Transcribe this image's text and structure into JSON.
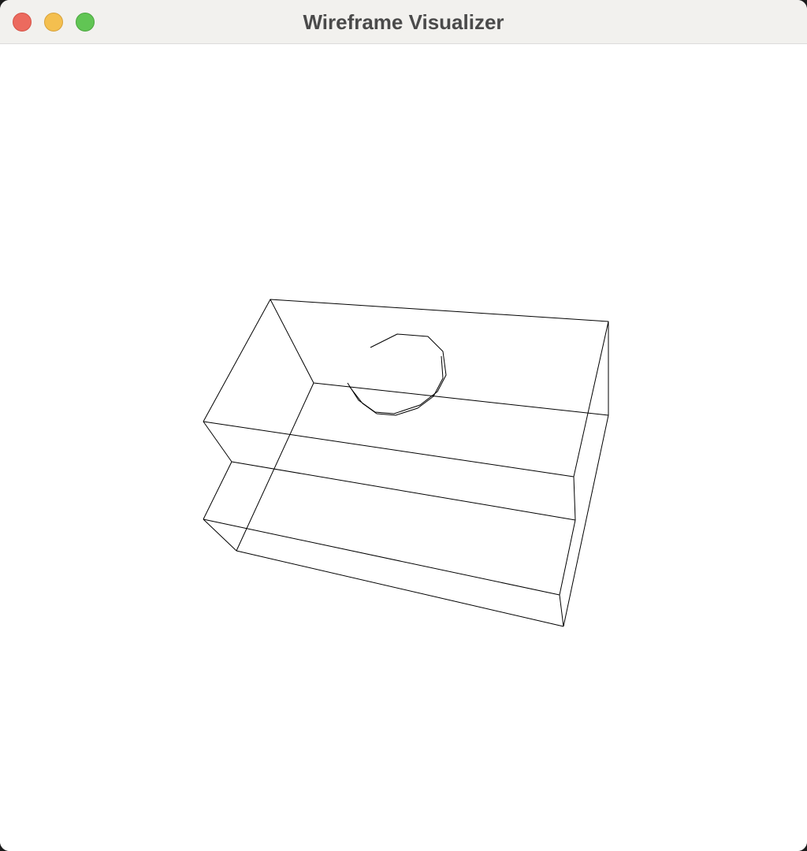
{
  "window": {
    "title": "Wireframe Visualizer"
  },
  "traffic_lights": [
    {
      "name": "close",
      "color": "#ec6a5e"
    },
    {
      "name": "minimize",
      "color": "#f4bf4f"
    },
    {
      "name": "zoom",
      "color": "#61c554"
    }
  ],
  "viewport": {
    "background": "#ffffff",
    "stroke_color": "#000000",
    "model": {
      "shapes": [
        "box",
        "step",
        "helix"
      ]
    }
  }
}
